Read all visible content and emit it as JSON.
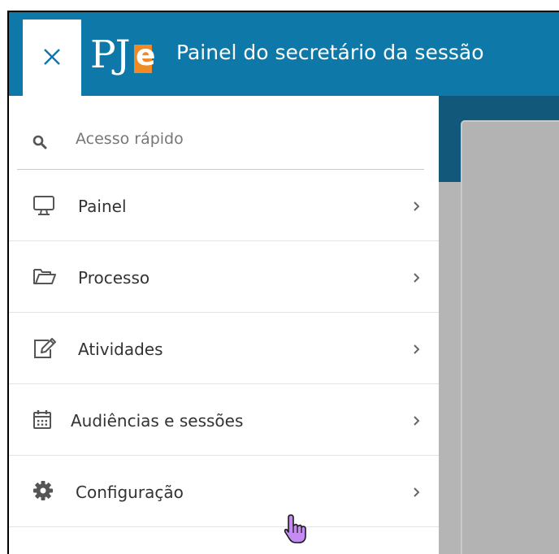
{
  "header": {
    "close_icon": "close-icon",
    "logo_text": "PJe",
    "title": "Painel do secretário da sessão",
    "color": "#0e78a9"
  },
  "search": {
    "icon": "search-icon",
    "placeholder": "Acesso rápido"
  },
  "menu": {
    "items": [
      {
        "icon": "monitor-icon",
        "label": "Painel"
      },
      {
        "icon": "folder-open-icon",
        "label": "Processo"
      },
      {
        "icon": "edit-icon",
        "label": "Atividades"
      },
      {
        "icon": "calendar-icon",
        "label": "Audiências e sessões"
      },
      {
        "icon": "gear-icon",
        "label": "Configuração"
      }
    ]
  },
  "accent_orange": "#f08a24",
  "cursor_icon": "hand-pointer-icon"
}
